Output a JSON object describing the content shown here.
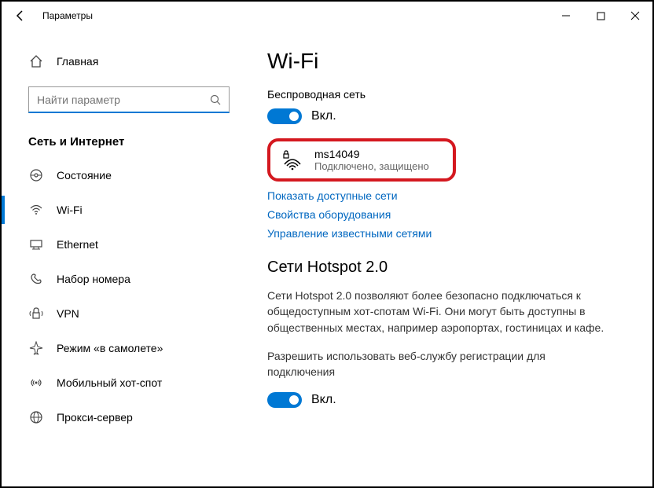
{
  "window": {
    "title": "Параметры"
  },
  "sidebar": {
    "home": "Главная",
    "search_placeholder": "Найти параметр",
    "section": "Сеть и Интернет",
    "items": [
      {
        "id": "status",
        "label": "Состояние"
      },
      {
        "id": "wifi",
        "label": "Wi-Fi"
      },
      {
        "id": "ethernet",
        "label": "Ethernet"
      },
      {
        "id": "dialup",
        "label": "Набор номера"
      },
      {
        "id": "vpn",
        "label": "VPN"
      },
      {
        "id": "airplane",
        "label": "Режим «в самолете»"
      },
      {
        "id": "hotspot",
        "label": "Мобильный хот-спот"
      },
      {
        "id": "proxy",
        "label": "Прокси-сервер"
      }
    ]
  },
  "main": {
    "title": "Wi-Fi",
    "wireless_label": "Беспроводная сеть",
    "toggle_state": "Вкл.",
    "network": {
      "name": "ms14049",
      "status": "Подключено, защищено"
    },
    "links": {
      "show_networks": "Показать доступные сети",
      "hw_properties": "Свойства оборудования",
      "manage_known": "Управление известными сетями"
    },
    "hotspot": {
      "heading": "Сети Hotspot 2.0",
      "desc": "Сети Hotspot 2.0 позволяют более безопасно подключаться к общедоступным хот-спотам Wi-Fi. Они могут быть доступны в общественных местах, например аэропортах, гостиницах и кафе.",
      "allow_label": "Разрешить использовать веб-службу регистрации для подключения",
      "toggle_state": "Вкл."
    }
  }
}
